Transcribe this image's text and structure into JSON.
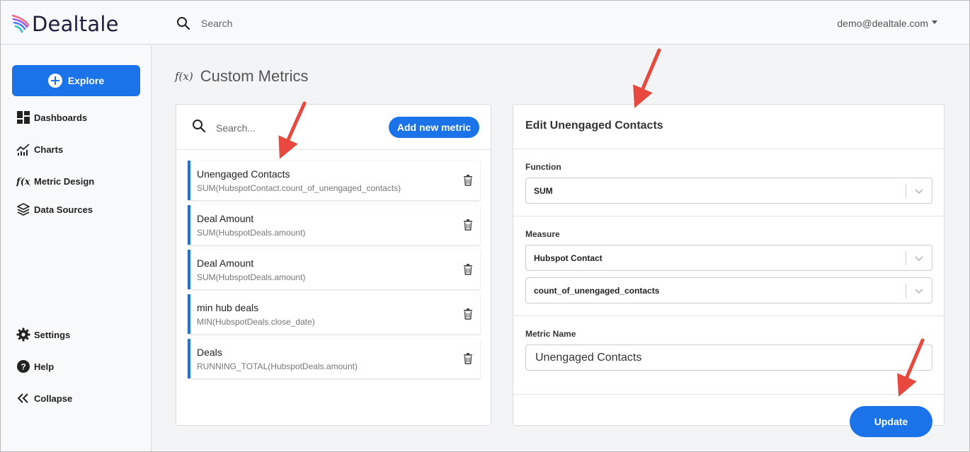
{
  "brand": {
    "name": "Dealtale"
  },
  "topbar": {
    "search_label": "Search",
    "user": "demo@dealtale.com"
  },
  "sidebar": {
    "explore_label": "Explore",
    "items": [
      {
        "label": "Dashboards",
        "icon": "dashboard-icon"
      },
      {
        "label": "Charts",
        "icon": "chart-icon"
      },
      {
        "label": "Metric Design",
        "icon": "function-icon"
      },
      {
        "label": "Data Sources",
        "icon": "layers-icon"
      }
    ],
    "bottom_items": [
      {
        "label": "Settings",
        "icon": "gear-icon"
      },
      {
        "label": "Help",
        "icon": "help-icon"
      },
      {
        "label": "Collapse",
        "icon": "double-chevron-left-icon"
      }
    ]
  },
  "page": {
    "title": "Custom Metrics",
    "title_icon_text": "f(x)"
  },
  "metrics_panel": {
    "search_placeholder": "Search...",
    "add_button": "Add new metric",
    "items": [
      {
        "name": "Unengaged Contacts",
        "formula": "SUM(HubspotContact.count_of_unengaged_contacts)"
      },
      {
        "name": "Deal Amount",
        "formula": "SUM(HubspotDeals.amount)"
      },
      {
        "name": "Deal Amount",
        "formula": "SUM(HubspotDeals.amount)"
      },
      {
        "name": "min hub deals",
        "formula": "MIN(HubspotDeals.close_date)"
      },
      {
        "name": "Deals",
        "formula": "RUNNING_TOTAL(HubspotDeals.amount)"
      }
    ]
  },
  "edit_panel": {
    "title": "Edit Unengaged Contacts",
    "function_label": "Function",
    "function_value": "SUM",
    "measure_label": "Measure",
    "measure_value": "Hubspot Contact",
    "measure_field_value": "count_of_unengaged_contacts",
    "metric_name_label": "Metric Name",
    "metric_name_value": "Unengaged Contacts",
    "update_button": "Update"
  },
  "colors": {
    "accent": "#1a73e8",
    "annotation_arrow": "#e8483d"
  }
}
